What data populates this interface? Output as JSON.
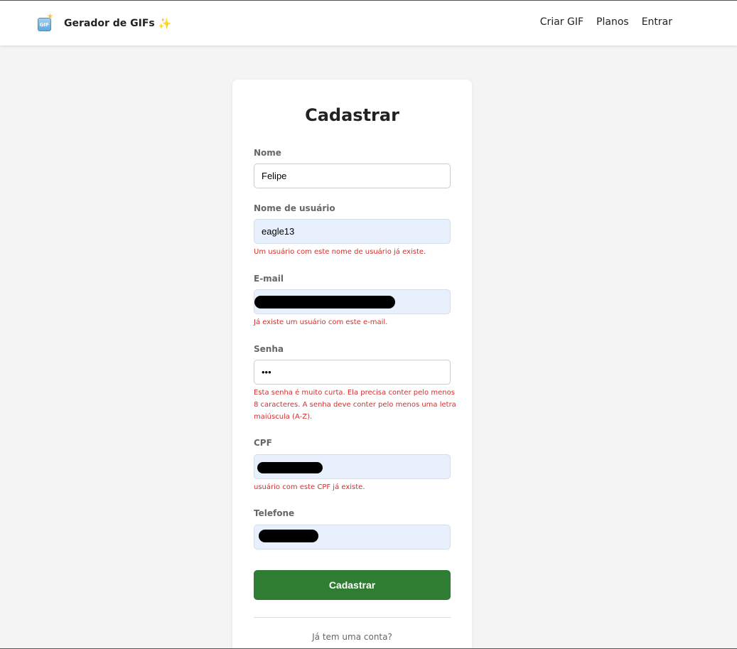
{
  "header": {
    "brand_name": "Gerador de GIFs",
    "brand_emoji": "✨",
    "logo_text": "GIF",
    "nav": [
      {
        "label": "Criar GIF"
      },
      {
        "label": "Planos"
      },
      {
        "label": "Entrar"
      }
    ]
  },
  "form": {
    "title": "Cadastrar",
    "fields": {
      "nome": {
        "label": "Nome",
        "value": "Felipe"
      },
      "username": {
        "label": "Nome de usuário",
        "value": "eagle13",
        "error": "Um usuário com este nome de usuário já existe."
      },
      "email": {
        "label": "E-mail",
        "value": "",
        "error": "Já existe um usuário com este e-mail."
      },
      "senha": {
        "label": "Senha",
        "value": "•••",
        "error": "Esta senha é muito curta. Ela precisa conter pelo menos 8 caracteres. A senha deve conter pelo menos uma letra maiúscula (A-Z)."
      },
      "cpf": {
        "label": "CPF",
        "value": "",
        "error": "usuário com este CPF já existe."
      },
      "telefone": {
        "label": "Telefone",
        "value": ""
      }
    },
    "submit_label": "Cadastrar",
    "footer_text": "Já tem uma conta?"
  },
  "colors": {
    "primary_button": "#2e7d32",
    "error": "#d32f2f",
    "autofill_bg": "#e8f0fe"
  }
}
